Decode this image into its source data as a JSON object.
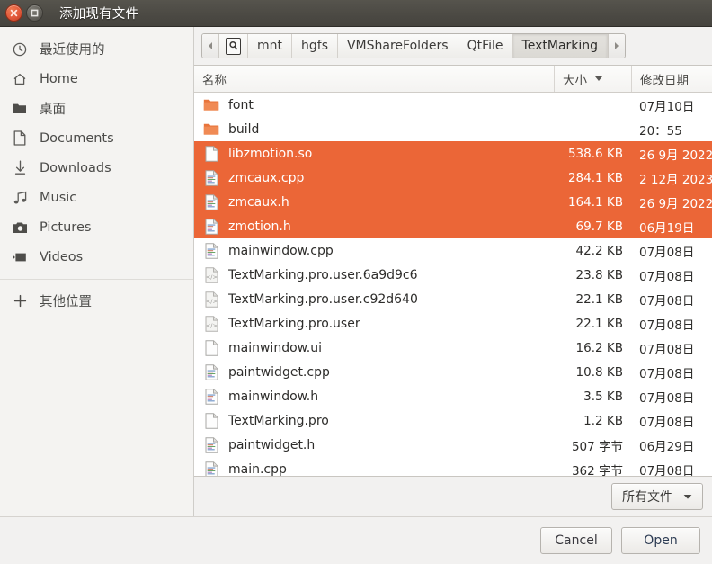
{
  "window": {
    "title": "添加现有文件",
    "close_icon": "close-icon",
    "maximize_icon": "maximize-icon"
  },
  "sidebar": {
    "items": [
      {
        "label": "最近使用的",
        "icon": "clock-icon"
      },
      {
        "label": "Home",
        "icon": "home-icon"
      },
      {
        "label": "桌面",
        "icon": "folder-icon"
      },
      {
        "label": "Documents",
        "icon": "document-icon"
      },
      {
        "label": "Downloads",
        "icon": "download-icon"
      },
      {
        "label": "Music",
        "icon": "music-note-icon"
      },
      {
        "label": "Pictures",
        "icon": "camera-icon"
      },
      {
        "label": "Videos",
        "icon": "video-icon"
      }
    ],
    "other": {
      "label": "其他位置",
      "icon": "plus-icon"
    }
  },
  "pathbar": {
    "prev_icon": "chevron-left-icon",
    "next_icon": "chevron-right-icon",
    "root_icon": "filesystem-disk-icon",
    "crumbs": [
      {
        "label": "mnt",
        "active": false
      },
      {
        "label": "hgfs",
        "active": false
      },
      {
        "label": "VMShareFolders",
        "active": false
      },
      {
        "label": "QtFile",
        "active": false
      },
      {
        "label": "TextMarking",
        "active": true
      }
    ]
  },
  "filelist": {
    "columns": {
      "name": "名称",
      "size": "大小",
      "date": "修改日期",
      "sort_icon": "sort-descending-caret-icon",
      "sorted_by": "大小"
    },
    "rows": [
      {
        "name": "font",
        "size": "",
        "date": "07月10日",
        "type": "folder",
        "selected": false
      },
      {
        "name": "build",
        "size": "",
        "date": "20：55",
        "type": "folder",
        "selected": false
      },
      {
        "name": "libzmotion.so",
        "size": "538.6 KB",
        "date": "26 9月 2022",
        "type": "plain",
        "selected": true
      },
      {
        "name": "zmcaux.cpp",
        "size": "284.1 KB",
        "date": "2 12月 2023",
        "type": "code",
        "selected": true
      },
      {
        "name": "zmcaux.h",
        "size": "164.1 KB",
        "date": "26 9月 2022",
        "type": "code",
        "selected": true
      },
      {
        "name": "zmotion.h",
        "size": "69.7 KB",
        "date": "06月19日",
        "type": "code",
        "selected": true
      },
      {
        "name": "mainwindow.cpp",
        "size": "42.2 KB",
        "date": "07月08日",
        "type": "code",
        "selected": false
      },
      {
        "name": "TextMarking.pro.user.6a9d9c6",
        "size": "23.8 KB",
        "date": "07月08日",
        "type": "xml",
        "selected": false
      },
      {
        "name": "TextMarking.pro.user.c92d640",
        "size": "22.1 KB",
        "date": "07月08日",
        "type": "xml",
        "selected": false
      },
      {
        "name": "TextMarking.pro.user",
        "size": "22.1 KB",
        "date": "07月08日",
        "type": "xml",
        "selected": false
      },
      {
        "name": "mainwindow.ui",
        "size": "16.2 KB",
        "date": "07月08日",
        "type": "plain",
        "selected": false
      },
      {
        "name": "paintwidget.cpp",
        "size": "10.8 KB",
        "date": "07月08日",
        "type": "code",
        "selected": false
      },
      {
        "name": "mainwindow.h",
        "size": "3.5 KB",
        "date": "07月08日",
        "type": "code",
        "selected": false
      },
      {
        "name": "TextMarking.pro",
        "size": "1.2 KB",
        "date": "07月08日",
        "type": "plain",
        "selected": false
      },
      {
        "name": "paintwidget.h",
        "size": "507 字节",
        "date": "06月29日",
        "type": "code",
        "selected": false
      },
      {
        "name": "main.cpp",
        "size": "362 字节",
        "date": "07月08日",
        "type": "code",
        "selected": false
      }
    ]
  },
  "footer": {
    "filter_label": "所有文件",
    "filter_caret_icon": "chevron-down-icon",
    "cancel_label": "Cancel",
    "open_label": "Open"
  },
  "colors": {
    "selection": "#eb6637",
    "titlebar": "#4c4a44",
    "folder": "#e8743b",
    "sidebar_bg": "#f4f3f1"
  }
}
